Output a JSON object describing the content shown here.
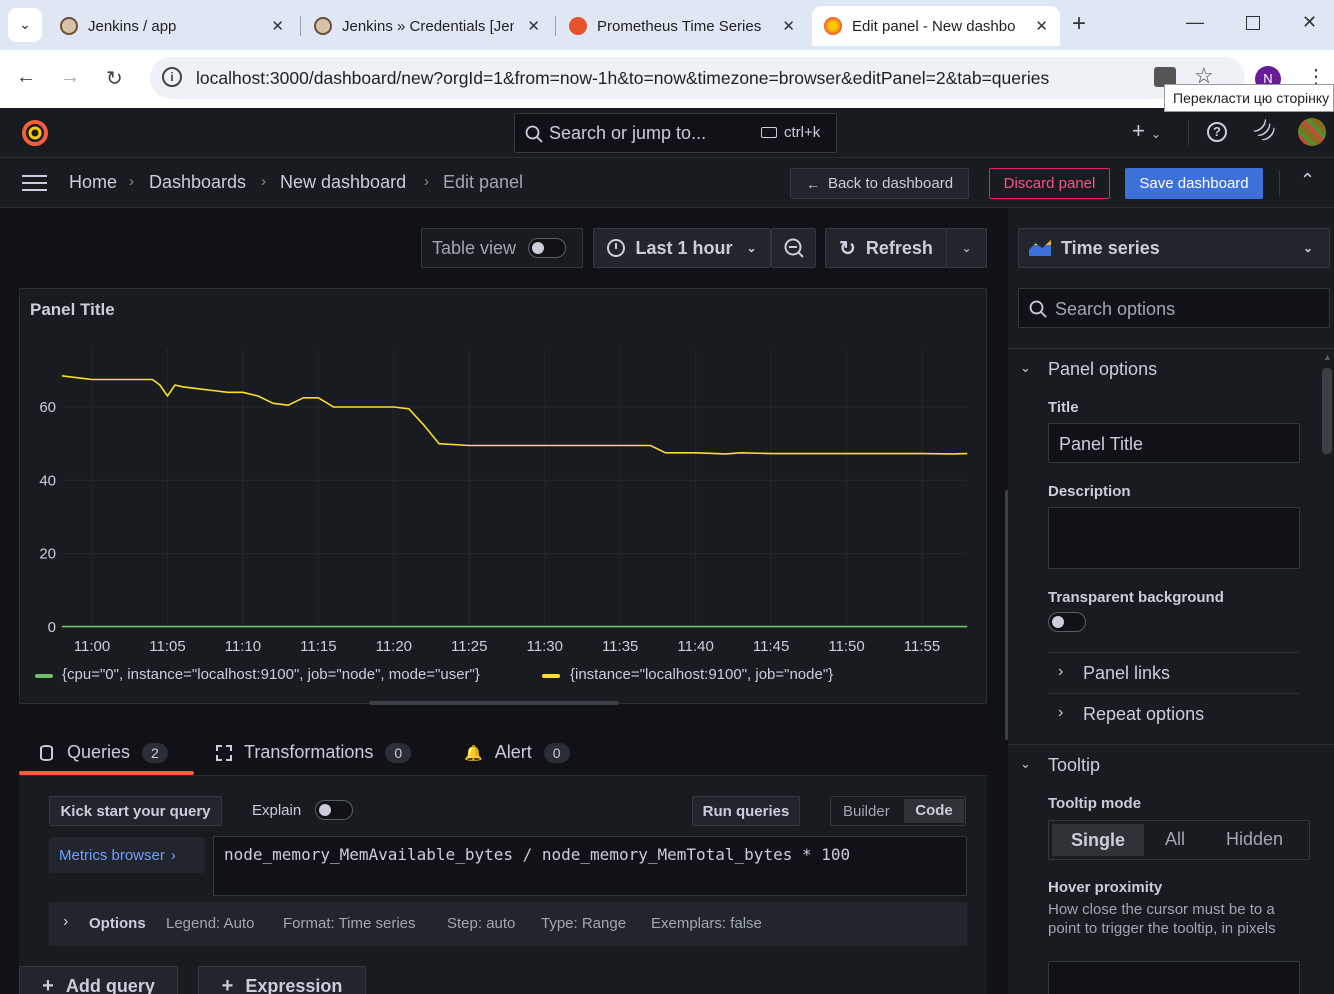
{
  "browser": {
    "tabs": [
      {
        "label": "Jenkins / app",
        "active": false
      },
      {
        "label": "Jenkins » Credentials [Jen",
        "active": false
      },
      {
        "label": "Prometheus Time Series",
        "active": false
      },
      {
        "label": "Edit panel - New dashbo",
        "active": true
      }
    ],
    "url": "localhost:3000/dashboard/new?orgId=1&from=now-1h&to=now&timezone=browser&editPanel=2&tab=queries",
    "translate_tooltip": "Перекласти цю сторінку",
    "profile_initial": "N"
  },
  "topnav": {
    "search_placeholder": "Search or jump to...",
    "search_shortcut": "ctrl+k",
    "plus": "+"
  },
  "breadcrumbs": [
    "Home",
    "Dashboards",
    "New dashboard",
    "Edit panel"
  ],
  "actions": {
    "back": "Back to dashboard",
    "discard": "Discard panel",
    "save": "Save dashboard"
  },
  "toolbar": {
    "table_view": "Table view",
    "time_range": "Last 1 hour",
    "refresh": "Refresh"
  },
  "panel": {
    "title": "Panel Title"
  },
  "chart_data": {
    "type": "line",
    "title": "Panel Title",
    "xlabel": "",
    "ylabel": "",
    "x_ticks": [
      "11:00",
      "11:05",
      "11:10",
      "11:15",
      "11:20",
      "11:25",
      "11:30",
      "11:35",
      "11:40",
      "11:45",
      "11:50",
      "11:55"
    ],
    "y_ticks": [
      "0",
      "20",
      "40",
      "60"
    ],
    "ylim": [
      0,
      76
    ],
    "xlim": [
      "10:58",
      "11:58"
    ],
    "grid": true,
    "legend_position": "bottom",
    "series": [
      {
        "name": "{cpu=\"0\", instance=\"localhost:9100\", job=\"node\", mode=\"user\"}",
        "color": "#73bf69",
        "x": [
          "10:58",
          "11:58"
        ],
        "values": [
          0.1,
          0.1
        ]
      },
      {
        "name": "{instance=\"localhost:9100\", job=\"node\"}",
        "color": "#fade2a",
        "x": [
          "10:58",
          "10:59",
          "11:00",
          "11:02",
          "11:04",
          "11:04:30",
          "11:05",
          "11:05:30",
          "11:06",
          "11:07",
          "11:08",
          "11:09",
          "11:10",
          "11:11",
          "11:12",
          "11:13",
          "11:14",
          "11:15",
          "11:16",
          "11:18",
          "11:20",
          "11:21",
          "11:22",
          "11:23",
          "11:25",
          "11:27",
          "11:30",
          "11:32",
          "11:35",
          "11:37",
          "11:38",
          "11:40",
          "11:42",
          "11:43",
          "11:45",
          "11:48",
          "11:50",
          "11:55",
          "11:57",
          "11:58"
        ],
        "values": [
          68.5,
          68,
          67.5,
          67.5,
          67.5,
          66,
          63,
          66,
          65.5,
          65,
          64.5,
          64,
          64,
          63,
          61,
          60.5,
          62.5,
          62.5,
          60,
          60,
          60,
          59.5,
          55,
          50,
          49.5,
          49.5,
          49.5,
          49.5,
          49.5,
          49.5,
          47.5,
          47.5,
          47.2,
          47.5,
          47.3,
          47.3,
          47.3,
          47.3,
          47.2,
          47.3
        ]
      }
    ]
  },
  "query_tabs": [
    {
      "label": "Queries",
      "count": "2"
    },
    {
      "label": "Transformations",
      "count": "0"
    },
    {
      "label": "Alert",
      "count": "0"
    }
  ],
  "query_editor": {
    "kick_start": "Kick start your query",
    "explain": "Explain",
    "run_queries": "Run queries",
    "builder": "Builder",
    "code": "Code",
    "metrics_browser": "Metrics browser",
    "expression": "node_memory_MemAvailable_bytes / node_memory_MemTotal_bytes * 100",
    "options_label": "Options",
    "options": [
      "Legend: Auto",
      "Format: Time series",
      "Step: auto",
      "Type: Range",
      "Exemplars: false"
    ],
    "add_query": "Add query",
    "add_expression": "Expression"
  },
  "right_pane": {
    "visualization": "Time series",
    "search_placeholder": "Search options",
    "panel_options_header": "Panel options",
    "title_label": "Title",
    "title_value": "Panel Title",
    "description_label": "Description",
    "transparent_label": "Transparent background",
    "panel_links": "Panel links",
    "repeat_options": "Repeat options",
    "tooltip_header": "Tooltip",
    "tooltip_mode_label": "Tooltip mode",
    "tooltip_modes": [
      "Single",
      "All",
      "Hidden"
    ],
    "hover_label": "Hover proximity",
    "hover_desc": "How close the cursor must be to a point to trigger the tooltip, in pixels"
  },
  "colors": {
    "grafana_orange": "#f55f3e",
    "save_blue": "#3d71d9",
    "discard_red": "#e0226e",
    "query_tab_underline": "#f55f3e",
    "link_blue": "#6e9fff"
  }
}
